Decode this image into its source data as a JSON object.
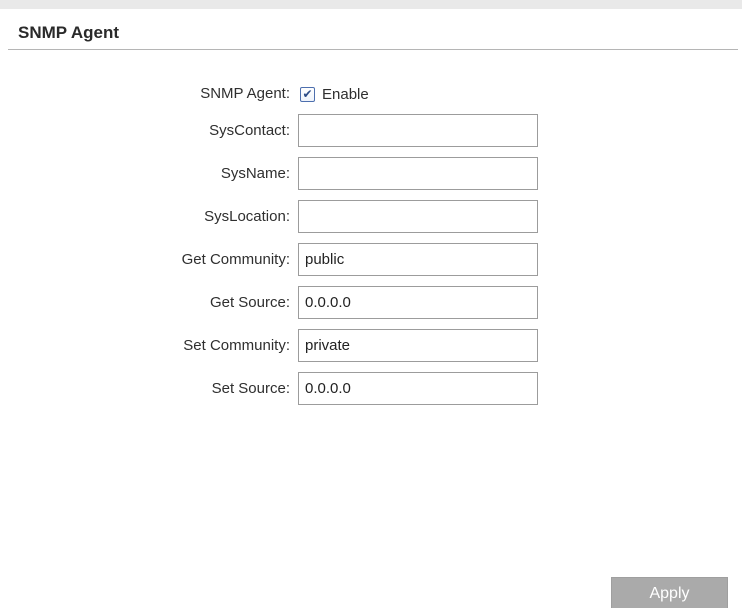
{
  "section": {
    "title": "SNMP Agent"
  },
  "snmp_agent": {
    "label": "SNMP Agent:",
    "checkbox_label": "Enable",
    "enabled": true,
    "check_glyph": "✔"
  },
  "fields": {
    "sys_contact": {
      "label": "SysContact:",
      "value": ""
    },
    "sys_name": {
      "label": "SysName:",
      "value": ""
    },
    "sys_location": {
      "label": "SysLocation:",
      "value": ""
    },
    "get_community": {
      "label": "Get Community:",
      "value": "public"
    },
    "get_source": {
      "label": "Get Source:",
      "value": "0.0.0.0"
    },
    "set_community": {
      "label": "Set Community:",
      "value": "private"
    },
    "set_source": {
      "label": "Set Source:",
      "value": "0.0.0.0"
    }
  },
  "actions": {
    "apply_label": "Apply"
  },
  "colors": {
    "header_rule": "#b5b5b5",
    "field_border": "#9c9c9c",
    "button_bg": "#aaaaaa",
    "button_text": "#ffffff",
    "checkbox_accent": "#2b4b86"
  }
}
